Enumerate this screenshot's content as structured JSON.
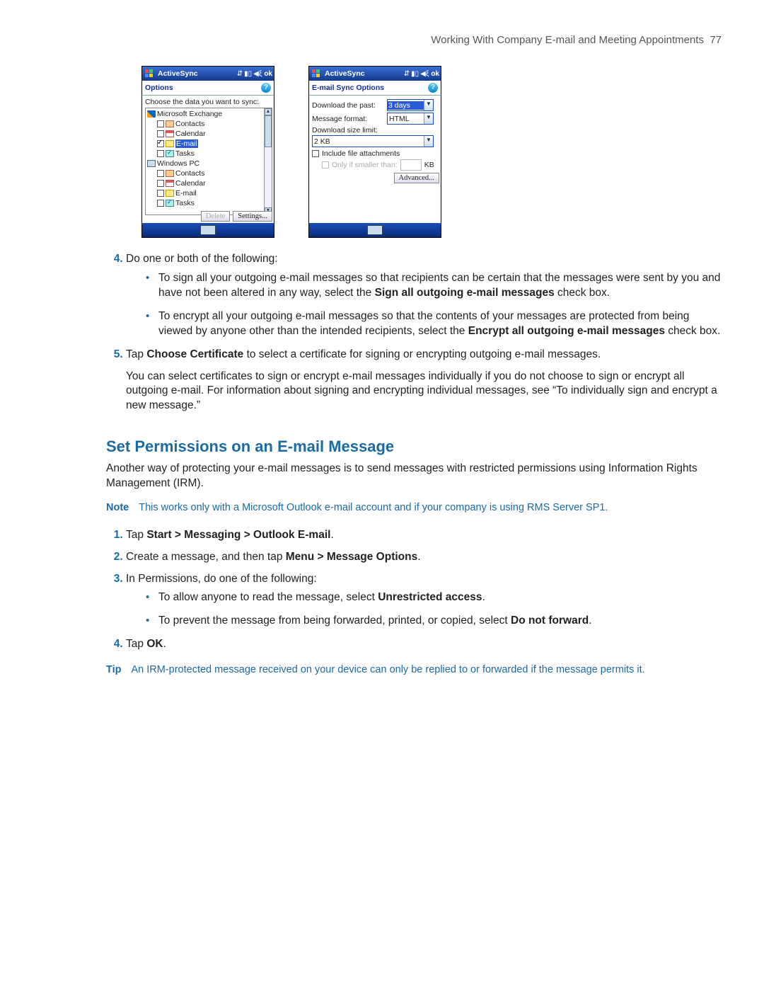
{
  "header": {
    "chapter": "Working With Company E-mail and Meeting Appointments",
    "page_number": "77"
  },
  "screenshot_left": {
    "app_title": "ActiveSync",
    "ok": "ok",
    "sub_title": "Options",
    "hint": "Choose the data you want to sync:",
    "groups": [
      {
        "label": "Microsoft Exchange",
        "icon": "exchange",
        "items": [
          {
            "label": "Contacts",
            "checked": false,
            "icon": "contacts"
          },
          {
            "label": "Calendar",
            "checked": false,
            "icon": "calendar"
          },
          {
            "label": "E-mail",
            "checked": true,
            "icon": "mail",
            "selected": true
          },
          {
            "label": "Tasks",
            "checked": false,
            "icon": "tasks"
          }
        ]
      },
      {
        "label": "Windows PC",
        "icon": "pc",
        "items": [
          {
            "label": "Contacts",
            "checked": false,
            "icon": "contacts"
          },
          {
            "label": "Calendar",
            "checked": false,
            "icon": "calendar"
          },
          {
            "label": "E-mail",
            "checked": false,
            "icon": "mail"
          },
          {
            "label": "Tasks",
            "checked": false,
            "icon": "tasks"
          }
        ]
      }
    ],
    "buttons": {
      "delete": "Delete",
      "settings": "Settings..."
    }
  },
  "screenshot_right": {
    "app_title": "ActiveSync",
    "ok": "ok",
    "sub_title": "E-mail Sync Options",
    "download_past_label": "Download the past:",
    "download_past_value": "3 days",
    "message_format_label": "Message format:",
    "message_format_value": "HTML",
    "download_limit_label": "Download size limit:",
    "download_limit_value": "2 KB",
    "include_attach_label": "Include file attachments",
    "only_smaller_label": "Only if smaller than:",
    "kb_unit": "KB",
    "advanced_btn": "Advanced..."
  },
  "steps": {
    "s4_intro": "Do one or both of the following:",
    "s4_b1_pre": "To sign all your outgoing e-mail messages so that recipients can be certain that the messages were sent by you and have not been altered in any way, select the ",
    "s4_b1_bold": "Sign all outgoing e-mail messages",
    "s4_b1_post": " check box.",
    "s4_b2_pre": "To encrypt all your outgoing e-mail messages so that the contents of your messages are protected from being viewed by anyone other than the intended recipients, select the ",
    "s4_b2_bold": "Encrypt all outgoing e-mail messages",
    "s4_b2_post": " check box.",
    "s5_pre": "Tap ",
    "s5_bold": "Choose Certificate",
    "s5_post": " to select a certificate for signing or encrypting outgoing e-mail messages.",
    "s5_para": "You can select certificates to sign or encrypt e-mail messages individually if you do not choose to sign or encrypt all outgoing e-mail. For information about signing and encrypting individual messages, see “To individually sign and encrypt a new message.”"
  },
  "section2": {
    "heading": "Set Permissions on an E-mail Message",
    "intro": "Another way of protecting your e-mail messages is to send messages with restricted permissions using Information Rights Management (IRM).",
    "note_tag": "Note",
    "note_text": "This works only with a Microsoft Outlook e-mail account and if your company is using RMS Server SP1.",
    "o1_pre": "Tap ",
    "o1_bold": "Start > Messaging > Outlook E-mail",
    "o1_post": ".",
    "o2_pre": "Create a message, and then tap ",
    "o2_bold": "Menu > Message Options",
    "o2_post": ".",
    "o3": "In Permissions, do one of the following:",
    "o3_b1_pre": "To allow anyone to read the message, select ",
    "o3_b1_bold": "Unrestricted access",
    "o3_b1_post": ".",
    "o3_b2_pre": "To prevent the message from being forwarded, printed, or copied, select ",
    "o3_b2_bold": "Do not forward",
    "o3_b2_post": ".",
    "o4_pre": "Tap ",
    "o4_bold": "OK",
    "o4_post": ".",
    "tip_tag": "Tip",
    "tip_text": "An IRM-protected message received on your device can only be replied to or forwarded if the message permits it."
  }
}
